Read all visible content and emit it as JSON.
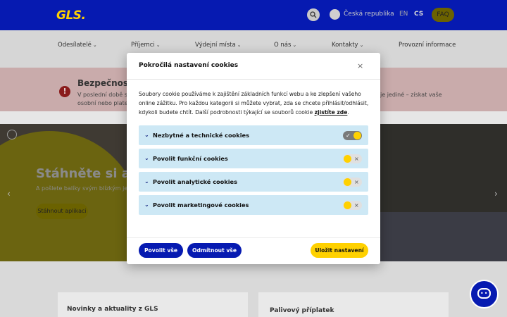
{
  "header": {
    "logo": "GLS.",
    "country": "Česká republika",
    "lang_en": "EN",
    "lang_cs": "CS",
    "faq": "FAQ"
  },
  "nav": {
    "items": [
      {
        "label": "Odesílatelé"
      },
      {
        "label": "Příjemci"
      },
      {
        "label": "Výdejní místa"
      },
      {
        "label": "O nás"
      },
      {
        "label": "Kontakty"
      },
      {
        "label": "Provozní informace"
      }
    ]
  },
  "alert": {
    "title": "Bezpečnost",
    "line1": "V poslední době se",
    "line2": "osobní nebo plate",
    "line3": "je jediné – získat vaše"
  },
  "hero": {
    "title": "Stáhněte si a",
    "subtitle": "A pošlete balíky svým blízkým jed",
    "button": "Stáhnout aplikaci"
  },
  "cards": {
    "news": "Novinky a aktuality z GLS",
    "fuel": "Palivový příplatek"
  },
  "modal": {
    "title": "Pokročilá nastavení cookies",
    "close": "×",
    "description": "Soubory cookie používáme k zajištění základních funkcí webu a ke zlepšení vašeho online zážitku. Pro každou kategorii si můžete vybrat, zda se chcete přihlásit/odhlásit, kdykoli budete chtít. Další podrobnosti týkající se souborů cookie",
    "link": "zjistíte zde",
    "categories": [
      {
        "label": "Nezbytné a technické cookies",
        "enabled": true
      },
      {
        "label": "Povolit funkční cookies",
        "enabled": false
      },
      {
        "label": "Povolit analytické cookies",
        "enabled": false
      },
      {
        "label": "Povolit marketingové cookies",
        "enabled": false
      }
    ],
    "buttons": {
      "allow_all": "Povolit vše",
      "reject_all": "Odmítnout vše",
      "save": "Uložit nastavení"
    }
  },
  "colors": {
    "brand_blue": "#061ab1",
    "brand_yellow": "#ffd100",
    "accordion_bg": "#cde8f5"
  }
}
